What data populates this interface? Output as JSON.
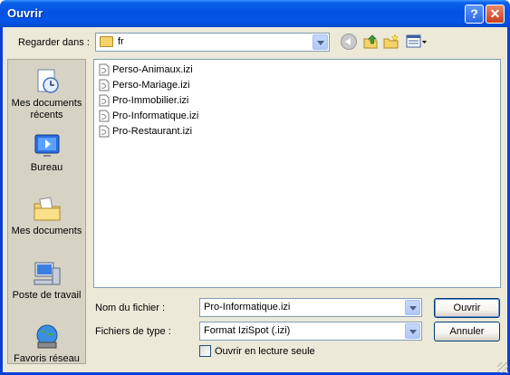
{
  "window": {
    "title": "Ouvrir",
    "help_label": "?",
    "close_label": "✕"
  },
  "lookin": {
    "label": "Regarder dans :",
    "value": "fr"
  },
  "toolbar": {
    "icons": [
      "back-icon",
      "up-folder-icon",
      "new-folder-icon",
      "views-icon"
    ]
  },
  "places": [
    {
      "label": "Mes documents récents",
      "icon": "recent-documents-icon"
    },
    {
      "label": "Bureau",
      "icon": "desktop-icon"
    },
    {
      "label": "Mes documents",
      "icon": "my-documents-icon"
    },
    {
      "label": "Poste de travail",
      "icon": "my-computer-icon"
    },
    {
      "label": "Favoris réseau",
      "icon": "network-places-icon"
    }
  ],
  "files": [
    {
      "name": "Perso-Animaux.izi"
    },
    {
      "name": "Perso-Mariage.izi"
    },
    {
      "name": "Pro-Immobilier.izi"
    },
    {
      "name": "Pro-Informatique.izi"
    },
    {
      "name": "Pro-Restaurant.izi"
    }
  ],
  "filename": {
    "label": "Nom du fichier :",
    "value": "Pro-Informatique.izi"
  },
  "filetype": {
    "label": "Fichiers de type :",
    "value": "Format IziSpot (.izi)"
  },
  "readonly": {
    "label": "Ouvrir en lecture seule",
    "checked": false
  },
  "buttons": {
    "open": "Ouvrir",
    "cancel": "Annuler"
  }
}
